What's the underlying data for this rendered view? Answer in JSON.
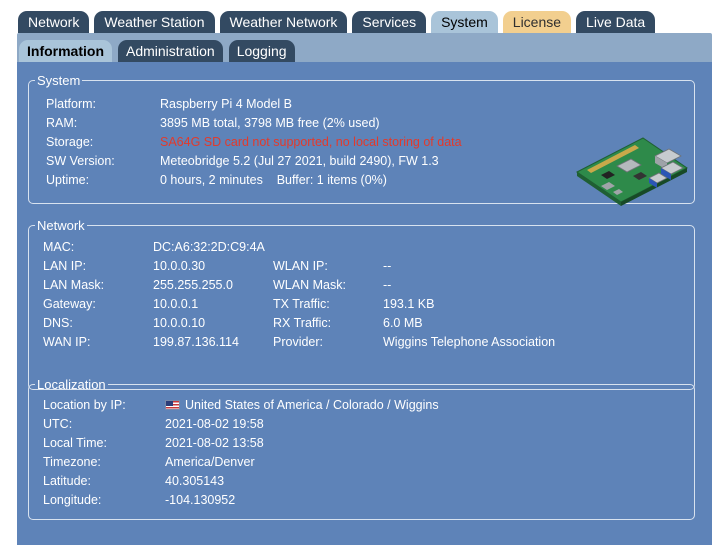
{
  "top_tabs": [
    {
      "label": "Network"
    },
    {
      "label": "Weather Station"
    },
    {
      "label": "Weather Network"
    },
    {
      "label": "Services"
    },
    {
      "label": "System"
    },
    {
      "label": "License"
    },
    {
      "label": "Live Data"
    }
  ],
  "sub_tabs": [
    {
      "label": "Information"
    },
    {
      "label": "Administration"
    },
    {
      "label": "Logging"
    }
  ],
  "system": {
    "legend": "System",
    "rows": [
      {
        "label": "Platform:",
        "value": "Raspberry Pi 4 Model B"
      },
      {
        "label": "RAM:",
        "value": "3895 MB total, 3798 MB free (2% used)"
      },
      {
        "label": "Storage:",
        "value": "SA64G SD card not supported, no local storing of data"
      },
      {
        "label": "SW Version:",
        "value": "Meteobridge 5.2 (Jul 27 2021, build 2490), FW 1.3"
      },
      {
        "label": "Uptime:",
        "value": "0 hours, 2 minutes    Buffer: 1 items (0%)"
      }
    ]
  },
  "network": {
    "legend": "Network",
    "mac": {
      "label": "MAC:",
      "value": "DC:A6:32:2D:C9:4A"
    },
    "rows": [
      {
        "label": "LAN IP:",
        "value": "10.0.0.30",
        "label2": "WLAN IP:",
        "value2": "--"
      },
      {
        "label": "LAN Mask:",
        "value": "255.255.255.0",
        "label2": "WLAN Mask:",
        "value2": "--"
      },
      {
        "label": "Gateway:",
        "value": "10.0.0.1",
        "label2": "TX Traffic:",
        "value2": "193.1 KB"
      },
      {
        "label": "DNS:",
        "value": "10.0.0.10",
        "label2": "RX Traffic:",
        "value2": "6.0 MB"
      },
      {
        "label": "WAN IP:",
        "value": "199.87.136.114",
        "label2": "Provider:",
        "value2": "Wiggins Telephone Association"
      }
    ]
  },
  "localization": {
    "legend": "Localization",
    "rows": [
      {
        "label": "Location by IP:",
        "value": "United States of America / Colorado / Wiggins"
      },
      {
        "label": "UTC:",
        "value": "2021-08-02 19:58"
      },
      {
        "label": "Local Time:",
        "value": "2021-08-02 13:58"
      },
      {
        "label": "Timezone:",
        "value": "America/Denver"
      },
      {
        "label": "Latitude:",
        "value": "40.305143"
      },
      {
        "label": "Longitude:",
        "value": "-104.130952"
      }
    ]
  },
  "colors": {
    "storage_error": "#e23a2c",
    "panel": "#5e83b8",
    "active_tab": "#a9c4d9",
    "license_tab": "#f2cf8f"
  }
}
